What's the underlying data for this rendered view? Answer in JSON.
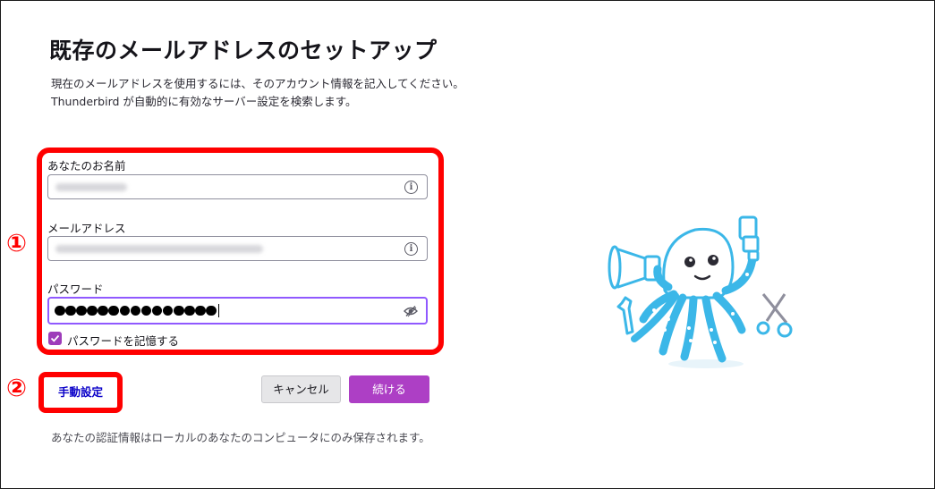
{
  "page": {
    "title": "既存のメールアドレスのセットアップ",
    "description_line1": "現在のメールアドレスを使用するには、そのアカウント情報を記入してください。",
    "description_line2": "Thunderbird が自動的に有効なサーバー設定を検索します。"
  },
  "annotations": {
    "marker1": "①",
    "marker2": "②",
    "color": "#ff0000"
  },
  "form": {
    "name_label": "あなたのお名前",
    "email_label": "メールアドレス",
    "password_label": "パスワード",
    "password_masked_count": 15,
    "remember_label": "パスワードを記憶する",
    "remember_checked": true,
    "info_icon": "info-icon",
    "visibility_icon": "eye-slash-icon"
  },
  "actions": {
    "manual_label": "手動設定",
    "cancel_label": "キャンセル",
    "continue_label": "続ける"
  },
  "footer": {
    "note": "あなたの認証情報はローカルのあなたのコンピュータにのみ保存されます。"
  },
  "colors": {
    "accent": "#ad3fc5",
    "focus": "#9059ff",
    "link": "#0a00c8",
    "mascot": "#3bb7e8"
  }
}
